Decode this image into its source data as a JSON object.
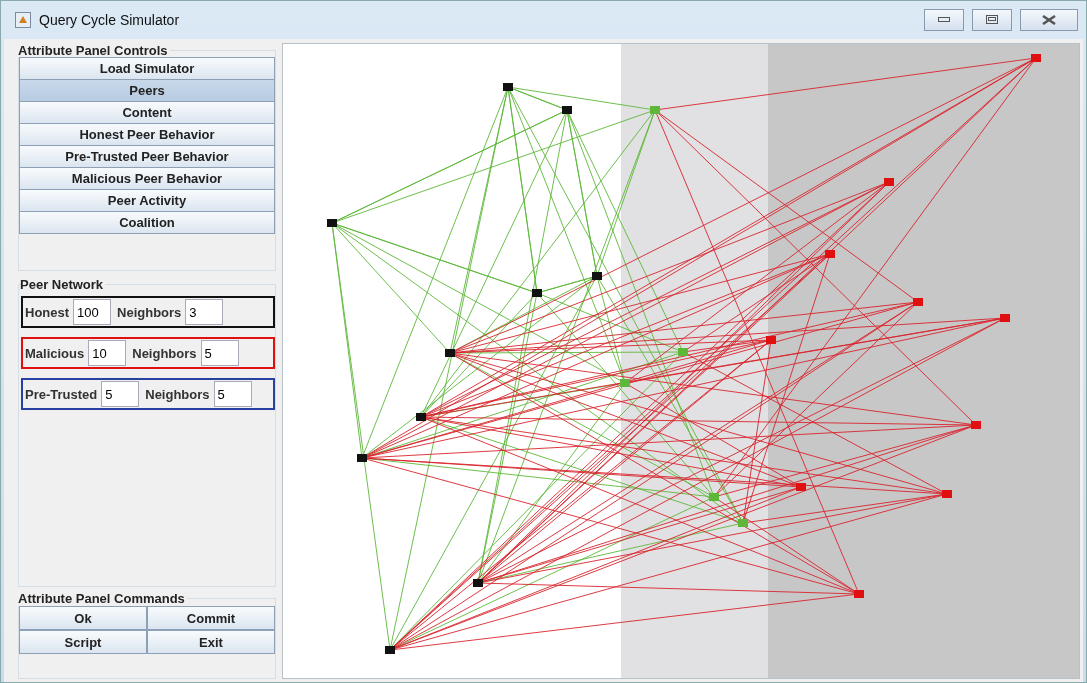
{
  "window": {
    "title": "Query Cycle Simulator"
  },
  "controls": {
    "title": "Attribute Panel Controls",
    "buttons": [
      {
        "label": "Load Simulator",
        "selected": false
      },
      {
        "label": "Peers",
        "selected": true
      },
      {
        "label": "Content",
        "selected": false
      },
      {
        "label": "Honest Peer Behavior",
        "selected": false
      },
      {
        "label": "Pre-Trusted Peer Behavior",
        "selected": false
      },
      {
        "label": "Malicious Peer Behavior",
        "selected": false
      },
      {
        "label": "Peer Activity",
        "selected": false
      },
      {
        "label": "Coalition",
        "selected": false
      }
    ]
  },
  "peer_network": {
    "title": "Peer Network",
    "rows": [
      {
        "label": "Honest",
        "value": "100",
        "neighbors_label": "Neighbors",
        "neighbors": "3",
        "color": "#111111"
      },
      {
        "label": "Malicious",
        "value": "10",
        "neighbors_label": "Neighbors",
        "neighbors": "5",
        "color": "#e01010"
      },
      {
        "label": "Pre-Trusted",
        "value": "5",
        "neighbors_label": "Neighbors",
        "neighbors": "5",
        "color": "#2840a0"
      }
    ]
  },
  "commands": {
    "title": "Attribute Panel Commands",
    "buttons": [
      "Ok",
      "Commit",
      "Script",
      "Exit"
    ]
  }
}
